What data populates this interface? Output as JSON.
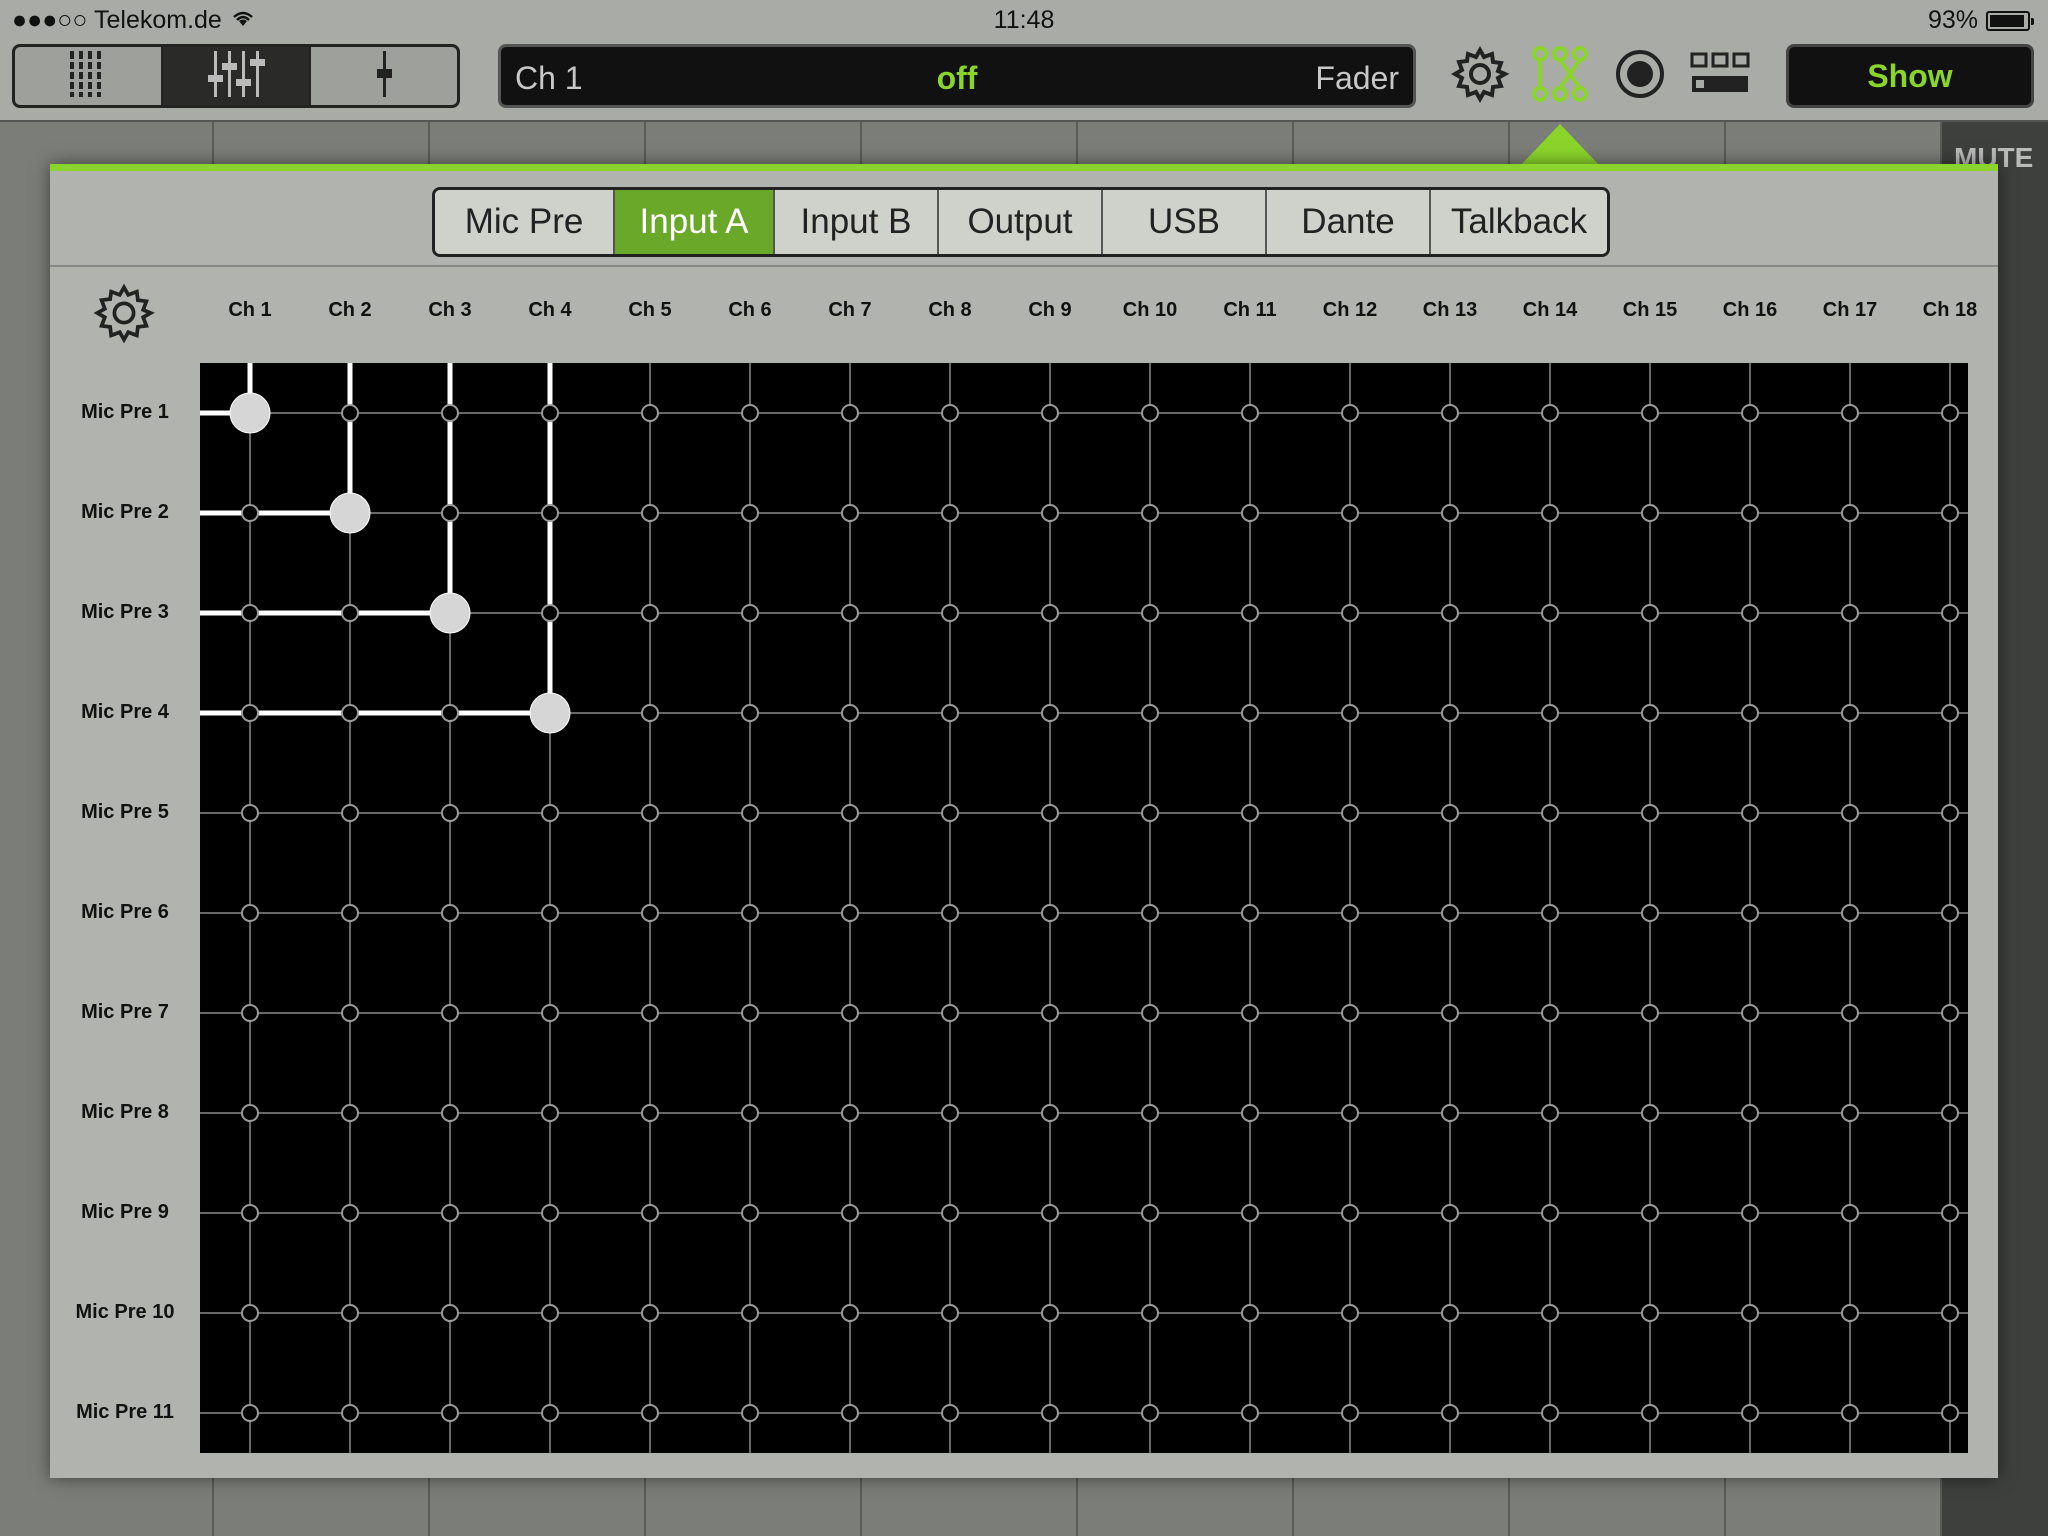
{
  "status_bar": {
    "carrier": "●●●○○ Telekom.de",
    "time": "11:48",
    "battery": "93%"
  },
  "toolbar": {
    "channel_name": "Ch 1",
    "channel_state": "off",
    "fader_label": "Fader",
    "show_label": "Show"
  },
  "background": {
    "mute_label": "MUTE"
  },
  "routing": {
    "tabs": [
      {
        "label": "Mic Pre",
        "active": false
      },
      {
        "label": "Input A",
        "active": true
      },
      {
        "label": "Input B",
        "active": false
      },
      {
        "label": "Output",
        "active": false
      },
      {
        "label": "USB",
        "active": false
      },
      {
        "label": "Dante",
        "active": false
      },
      {
        "label": "Talkback",
        "active": false
      }
    ],
    "columns": [
      "Ch 1",
      "Ch 2",
      "Ch 3",
      "Ch 4",
      "Ch 5",
      "Ch 6",
      "Ch 7",
      "Ch 8",
      "Ch 9",
      "Ch 10",
      "Ch 11",
      "Ch 12",
      "Ch 13",
      "Ch 14",
      "Ch 15",
      "Ch 16",
      "Ch 17",
      "Ch 18"
    ],
    "rows": [
      "Mic Pre 1",
      "Mic Pre 2",
      "Mic Pre 3",
      "Mic Pre 4",
      "Mic Pre 5",
      "Mic Pre 6",
      "Mic Pre 7",
      "Mic Pre 8",
      "Mic Pre 9",
      "Mic Pre 10",
      "Mic Pre 11"
    ],
    "routes": [
      {
        "row": 1,
        "column": 1
      },
      {
        "row": 2,
        "column": 2
      },
      {
        "row": 3,
        "column": 3
      },
      {
        "row": 4,
        "column": 4
      }
    ]
  },
  "colors": {
    "accent": "#8ad42b",
    "active_tab": "#6aa82a"
  }
}
